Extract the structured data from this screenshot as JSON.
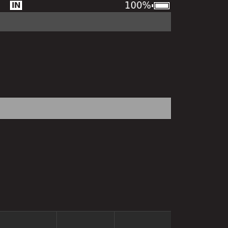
{
  "status_bar": {
    "input_mode": "IN",
    "battery_percent": "100%",
    "battery_level": 1.0
  },
  "header": {
    "title": ""
  },
  "list": {
    "highlighted_label": ""
  },
  "softkeys": {
    "left": "",
    "center": "",
    "right": ""
  },
  "colors": {
    "background": "#231f20",
    "header_bar": "#4d4d4d",
    "highlight": "#a0a0a0",
    "softkey_bar": "#2b2b2b"
  }
}
